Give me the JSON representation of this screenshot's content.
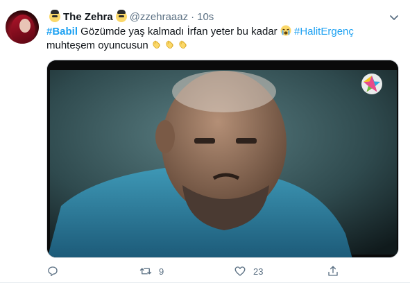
{
  "tweet": {
    "display_name": "The Zehra",
    "handle": "@zzehraaaz",
    "separator": "·",
    "time": "10s",
    "hashtag1": "#Babil",
    "text_part1": " Gözümde yaş kalmadı İrfan yeter bu kadar ",
    "hashtag2": "#HalitErgenç",
    "text_part2": "muhteşem oyuncusun ",
    "emojis": [
      "face-with-sunglasses-emoji",
      "loudly-crying-face-emoji",
      "clapping-hands-emoji"
    ],
    "media": {
      "description_icon": "tv-channel-star-logo"
    }
  },
  "actions": {
    "reply_count": "",
    "retweet_count": "9",
    "like_count": "23",
    "share_count": ""
  },
  "colors": {
    "link": "#1da1f2",
    "secondary_text": "#5b7083",
    "primary_text": "#0f1419"
  }
}
